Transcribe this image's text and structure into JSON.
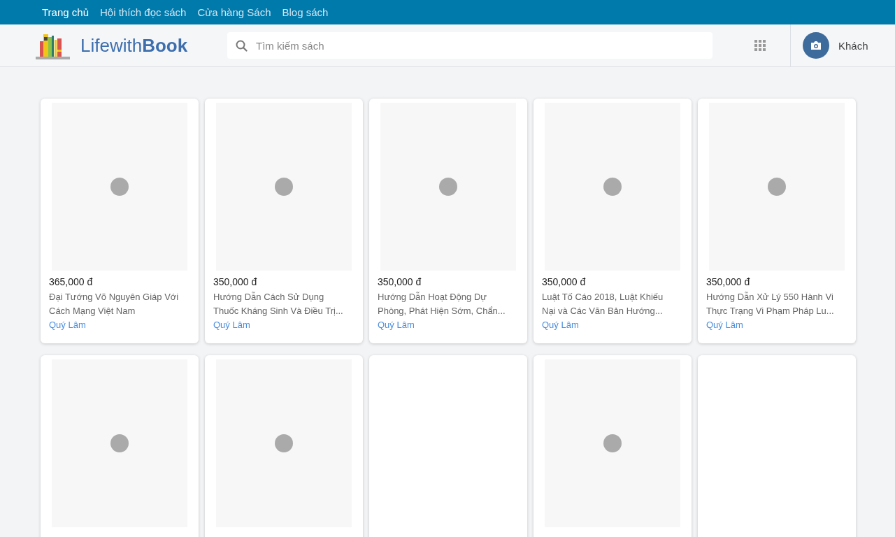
{
  "top_nav": [
    {
      "label": "Trang chủ",
      "selected": true
    },
    {
      "label": "Hội thích đọc sách",
      "selected": false
    },
    {
      "label": "Cửa hàng Sách",
      "selected": false
    },
    {
      "label": "Blog sách",
      "selected": false
    }
  ],
  "logo": {
    "light": "Lifewith",
    "bold": "Book"
  },
  "search": {
    "placeholder": "Tìm kiếm sách"
  },
  "user": {
    "name": "Khách"
  },
  "books": [
    {
      "image": true,
      "price": "365,000 đ",
      "title_lines": [
        "Đại Tướng Võ Nguyên Giáp Với",
        "Cách Mạng Việt Nam"
      ],
      "author": "Quý Lâm"
    },
    {
      "image": true,
      "price": "350,000 đ",
      "title_lines": [
        "Hướng Dẫn Cách Sử Dụng",
        "Thuốc Kháng Sinh Và Điều Trị..."
      ],
      "author": "Quý Lâm"
    },
    {
      "image": true,
      "price": "350,000 đ",
      "title_lines": [
        "Hướng Dẫn Hoạt Động Dự",
        "Phòng, Phát Hiện Sớm, Chẩn..."
      ],
      "author": "Quý Lâm"
    },
    {
      "image": true,
      "price": "350,000 đ",
      "title_lines": [
        "Luật Tố Cáo 2018, Luật Khiếu",
        "Nại và Các Văn Bản Hướng..."
      ],
      "author": "Quý Lâm"
    },
    {
      "image": true,
      "price": "350,000 đ",
      "title_lines": [
        "Hướng Dẫn Xử Lý 550 Hành Vi",
        "Thực Trạng Vi Phạm Pháp Lu..."
      ],
      "author": "Quý Lâm"
    },
    {
      "image": true
    },
    {
      "image": true
    },
    {
      "image": false
    },
    {
      "image": true
    },
    {
      "image": false
    }
  ]
}
